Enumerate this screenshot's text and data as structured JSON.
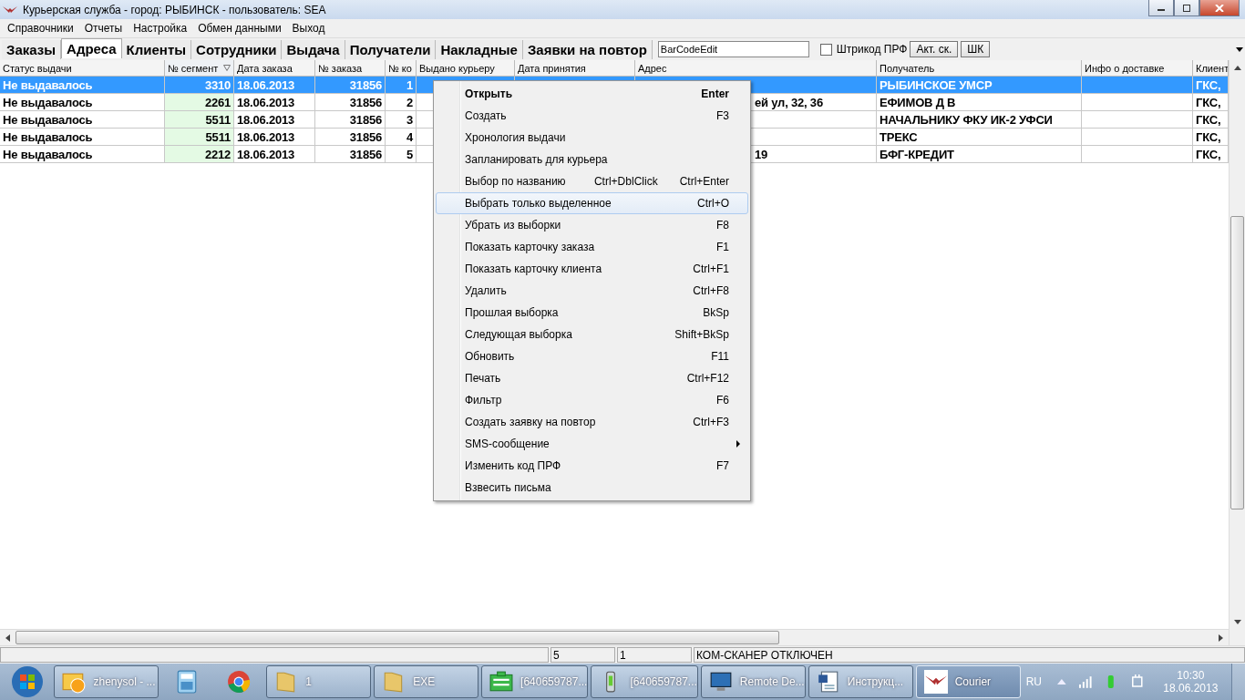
{
  "window": {
    "title": "Курьерская служба  - город: РЫБИНСК  - пользователь: SEA"
  },
  "menu_bar": [
    "Справочники",
    "Отчеты",
    "Настройка",
    "Обмен данными",
    "Выход"
  ],
  "tabs": [
    {
      "label": "Заказы",
      "selected": false
    },
    {
      "label": "Адреса",
      "selected": true
    },
    {
      "label": "Клиенты",
      "selected": false
    },
    {
      "label": "Сотрудники",
      "selected": false
    },
    {
      "label": "Выдача",
      "selected": false
    },
    {
      "label": "Получатели",
      "selected": false
    },
    {
      "label": "Накладные",
      "selected": false
    },
    {
      "label": "Заявки на повтор",
      "selected": false
    }
  ],
  "barcode_field": {
    "value": "BarCodeEdit"
  },
  "checkbox": {
    "label": "Штрикод ПРФ",
    "checked": false
  },
  "buttons": [
    "Акт. ск.",
    "ШК"
  ],
  "table": {
    "columns": [
      {
        "label": "Статус выдачи"
      },
      {
        "label": "№ сегмент",
        "sorted": true
      },
      {
        "label": "Дата заказа"
      },
      {
        "label": "№ заказа"
      },
      {
        "label": "№ ко"
      },
      {
        "label": "Выдано курьеру"
      },
      {
        "label": "Дата принятия"
      },
      {
        "label": "Адрес"
      },
      {
        "label": "Получатель"
      },
      {
        "label": "Инфо о доставке"
      },
      {
        "label": "Клиент"
      }
    ],
    "rows": [
      {
        "selected": true,
        "cells": [
          "Не выдавалось",
          "3310",
          "18.06.2013",
          "31856",
          "1",
          "",
          "",
          "",
          "РЫБИНСКОЕ УМСР",
          "",
          "ГКС,"
        ]
      },
      {
        "selected": false,
        "cells": [
          "Не выдавалось",
          "2261",
          "18.06.2013",
          "31856",
          "2",
          "",
          "",
          "ей ул, 32, 36",
          "ЕФИМОВ Д В",
          "",
          "ГКС,"
        ]
      },
      {
        "selected": false,
        "cells": [
          "Не выдавалось",
          "5511",
          "18.06.2013",
          "31856",
          "3",
          "",
          "",
          "",
          "НАЧАЛЬНИКУ ФКУ ИК-2 УФСИ",
          "",
          "ГКС,"
        ]
      },
      {
        "selected": false,
        "cells": [
          "Не выдавалось",
          "5511",
          "18.06.2013",
          "31856",
          "4",
          "",
          "",
          "",
          "ТРЕКС",
          "",
          "ГКС,"
        ]
      },
      {
        "selected": false,
        "cells": [
          "Не выдавалось",
          "2212",
          "18.06.2013",
          "31856",
          "5",
          "",
          "",
          "19",
          "БФГ-КРЕДИТ",
          "",
          "ГКС,"
        ]
      }
    ]
  },
  "context_menu": [
    {
      "label": "Открыть",
      "shortcuts": [
        "Enter"
      ],
      "bold": true,
      "highlighted": false,
      "submenu": false
    },
    {
      "label": "Создать",
      "shortcuts": [
        "F3"
      ],
      "bold": false,
      "highlighted": false,
      "submenu": false
    },
    {
      "label": "Хронология выдачи",
      "bold": false,
      "highlighted": false,
      "submenu": false
    },
    {
      "label": "Запланировать для курьера",
      "bold": false,
      "highlighted": false,
      "submenu": false
    },
    {
      "label": "Выбор по названию",
      "shortcuts": [
        "Ctrl+DblClick",
        "Ctrl+Enter"
      ],
      "bold": false,
      "highlighted": false,
      "submenu": false
    },
    {
      "label": "Выбрать только выделенное",
      "shortcuts": [
        "Ctrl+O"
      ],
      "bold": false,
      "highlighted": true,
      "submenu": false
    },
    {
      "label": "Убрать из выборки",
      "shortcuts": [
        "F8"
      ],
      "bold": false,
      "highlighted": false,
      "submenu": false
    },
    {
      "label": "Показать карточку заказа",
      "shortcuts": [
        "F1"
      ],
      "bold": false,
      "highlighted": false,
      "submenu": false
    },
    {
      "label": "Показать карточку клиента",
      "shortcuts": [
        "Ctrl+F1"
      ],
      "bold": false,
      "highlighted": false,
      "submenu": false
    },
    {
      "label": "Удалить",
      "shortcuts": [
        "Ctrl+F8"
      ],
      "bold": false,
      "highlighted": false,
      "submenu": false
    },
    {
      "label": "Прошлая выборка",
      "shortcuts": [
        "BkSp"
      ],
      "bold": false,
      "highlighted": false,
      "submenu": false
    },
    {
      "label": "Следующая выборка",
      "shortcuts": [
        "Shift+BkSp"
      ],
      "bold": false,
      "highlighted": false,
      "submenu": false
    },
    {
      "label": "Обновить",
      "shortcuts": [
        "F11"
      ],
      "bold": false,
      "highlighted": false,
      "submenu": false
    },
    {
      "label": "Печать",
      "shortcuts": [
        "Ctrl+F12"
      ],
      "bold": false,
      "highlighted": false,
      "submenu": false
    },
    {
      "label": "Фильтр",
      "shortcuts": [
        "F6"
      ],
      "bold": false,
      "highlighted": false,
      "submenu": false
    },
    {
      "label": "Создать заявку на повтор",
      "shortcuts": [
        "Ctrl+F3"
      ],
      "bold": false,
      "highlighted": false,
      "submenu": false
    },
    {
      "label": "SMS-сообщение",
      "bold": false,
      "highlighted": false,
      "submenu": true
    },
    {
      "label": "Изменить код ПРФ",
      "shortcuts": [
        "F7"
      ],
      "bold": false,
      "highlighted": false,
      "submenu": false
    },
    {
      "label": "Взвесить письма",
      "bold": false,
      "highlighted": false,
      "submenu": false
    }
  ],
  "status_bar": [
    "5",
    "1",
    "КОМ-СКАНЕР ОТКЛЮЧЕН"
  ],
  "taskbar": {
    "items": [
      {
        "kind": "mail",
        "label": "zhenysol - ...",
        "active": false
      },
      {
        "kind": "calculator",
        "active": false
      },
      {
        "kind": "browser",
        "active": false
      },
      {
        "kind": "folder",
        "label": "1",
        "active": false
      },
      {
        "kind": "folder",
        "label": "EXE",
        "active": false
      },
      {
        "kind": "card",
        "label": "[640659787...",
        "active": false
      },
      {
        "kind": "phone",
        "label": "[640659787...",
        "active": false
      },
      {
        "kind": "remote",
        "label": "Remote De...",
        "active": false
      },
      {
        "kind": "document",
        "label": "Инструкц...",
        "active": false
      },
      {
        "kind": "wings",
        "label": "Courier",
        "active": true
      }
    ],
    "language": "RU",
    "time": "10:30",
    "date": "18.06.2013"
  }
}
